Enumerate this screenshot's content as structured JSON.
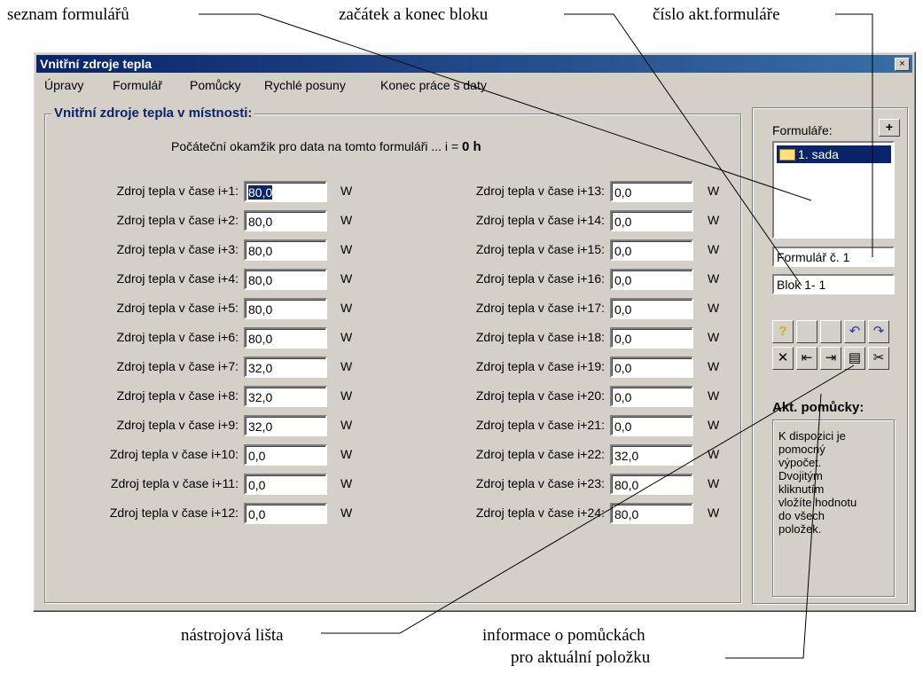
{
  "callouts": {
    "form_list": "seznam formulářů",
    "block_range": "začátek a konec bloku",
    "form_number": "číslo akt.formuláře",
    "toolbar": "nástrojová lišta",
    "help_info_line1": "informace o pomůckách",
    "help_info_line2": "pro aktuální položku"
  },
  "window": {
    "title": "Vnitřní zdroje tepla",
    "close": "×"
  },
  "menu": [
    "Úpravy",
    "Formulář",
    "Pomůcky",
    "Rychlé posuny",
    "Konec práce s daty"
  ],
  "group": {
    "title": "Vnitřní zdroje tepla v místnosti:",
    "start_text": "Počáteční okamžik pro data na tomto formuláři ... i =",
    "start_value": "0 h"
  },
  "rows_left": [
    {
      "label": "Zdroj tepla v čase i+1:",
      "value": "80,0",
      "unit": "W"
    },
    {
      "label": "Zdroj tepla v čase i+2:",
      "value": "80,0",
      "unit": "W"
    },
    {
      "label": "Zdroj tepla v čase i+3:",
      "value": "80,0",
      "unit": "W"
    },
    {
      "label": "Zdroj tepla v čase i+4:",
      "value": "80,0",
      "unit": "W"
    },
    {
      "label": "Zdroj tepla v čase i+5:",
      "value": "80,0",
      "unit": "W"
    },
    {
      "label": "Zdroj tepla v čase i+6:",
      "value": "80,0",
      "unit": "W"
    },
    {
      "label": "Zdroj tepla v čase i+7:",
      "value": "32,0",
      "unit": "W"
    },
    {
      "label": "Zdroj tepla v čase i+8:",
      "value": "32,0",
      "unit": "W"
    },
    {
      "label": "Zdroj tepla v čase i+9:",
      "value": "32,0",
      "unit": "W"
    },
    {
      "label": "Zdroj tepla v čase i+10:",
      "value": "0,0",
      "unit": "W"
    },
    {
      "label": "Zdroj tepla v čase i+11:",
      "value": "0,0",
      "unit": "W"
    },
    {
      "label": "Zdroj tepla v čase i+12:",
      "value": "0,0",
      "unit": "W"
    }
  ],
  "rows_right": [
    {
      "label": "Zdroj tepla v čase i+13:",
      "value": "0,0",
      "unit": "W"
    },
    {
      "label": "Zdroj tepla v čase i+14:",
      "value": "0,0",
      "unit": "W"
    },
    {
      "label": "Zdroj tepla v čase i+15:",
      "value": "0,0",
      "unit": "W"
    },
    {
      "label": "Zdroj tepla v čase i+16:",
      "value": "0,0",
      "unit": "W"
    },
    {
      "label": "Zdroj tepla v čase i+17:",
      "value": "0,0",
      "unit": "W"
    },
    {
      "label": "Zdroj tepla v čase i+18:",
      "value": "0,0",
      "unit": "W"
    },
    {
      "label": "Zdroj tepla v čase i+19:",
      "value": "0,0",
      "unit": "W"
    },
    {
      "label": "Zdroj tepla v čase i+20:",
      "value": "0,0",
      "unit": "W"
    },
    {
      "label": "Zdroj tepla v čase i+21:",
      "value": "0,0",
      "unit": "W"
    },
    {
      "label": "Zdroj tepla v čase i+22:",
      "value": "32,0",
      "unit": "W"
    },
    {
      "label": "Zdroj tepla v čase i+23:",
      "value": "80,0",
      "unit": "W"
    },
    {
      "label": "Zdroj tepla v čase i+24:",
      "value": "80,0",
      "unit": "W"
    }
  ],
  "side": {
    "forms_label": "Formuláře:",
    "add_button": "+",
    "forms": [
      "1. sada"
    ],
    "form_number": "Formulář č. 1",
    "block": "Blok 1- 1",
    "help_title": "Akt. pomůcky:",
    "help_lines": [
      "K dispozici je",
      "pomocný",
      "výpočet.",
      "Dvojitým",
      "kliknutím",
      "vložíte hodnotu",
      "do všech",
      "položek."
    ]
  },
  "toolbar": {
    "row1": [
      {
        "icon": "help-icon",
        "glyph": "?"
      },
      {
        "icon": "empty-icon",
        "glyph": ""
      },
      {
        "icon": "empty-icon",
        "glyph": ""
      },
      {
        "icon": "undo-icon",
        "glyph": "↶"
      },
      {
        "icon": "redo-icon",
        "glyph": "↷"
      }
    ],
    "row2": [
      {
        "icon": "delete-icon",
        "glyph": "✕"
      },
      {
        "icon": "jump-start-icon",
        "glyph": "⇤"
      },
      {
        "icon": "jump-end-icon",
        "glyph": "⇥"
      },
      {
        "icon": "paste-icon",
        "glyph": "▤"
      },
      {
        "icon": "cut-icon",
        "glyph": "✂"
      }
    ]
  },
  "colors": {
    "titlebar": "#0a246a",
    "face": "#d4d0c8",
    "selection": "#0a246a",
    "help_icon": "#d8b000"
  }
}
